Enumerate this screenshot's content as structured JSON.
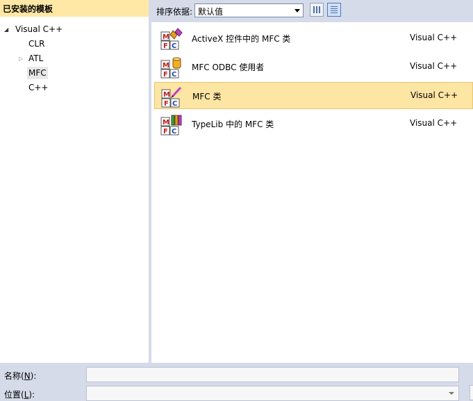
{
  "left_pane": {
    "header": "已安装的模板",
    "tree": [
      {
        "label": "Visual C++",
        "toggle": "◢"
      },
      {
        "label": "CLR"
      },
      {
        "label": "ATL",
        "toggle": "▷"
      },
      {
        "label": "MFC"
      },
      {
        "label": "C++"
      }
    ]
  },
  "toolbar": {
    "sort_label": "排序依据:",
    "sort_value": "默认值",
    "view_buttons": [
      "medium-icons",
      "small-icons"
    ]
  },
  "templates": [
    {
      "name": "ActiveX 控件中的 MFC 类",
      "language": "Visual C++",
      "icon": "mfc-activex-icon"
    },
    {
      "name": "MFC ODBC 使用者",
      "language": "Visual C++",
      "icon": "mfc-odbc-icon"
    },
    {
      "name": "MFC 类",
      "language": "Visual C++",
      "icon": "mfc-class-icon",
      "selected": true
    },
    {
      "name": "TypeLib 中的 MFC 类",
      "language": "Visual C++",
      "icon": "mfc-typelib-icon"
    }
  ],
  "fields": {
    "name": {
      "label": "名称(",
      "accel": "N",
      "suffix": "):",
      "value": ""
    },
    "location": {
      "label": "位置(",
      "accel": "L",
      "suffix": "):",
      "value": ""
    }
  },
  "colors": {
    "header_bg": "#ffe8a6",
    "selected_row": "#fde5a3",
    "chrome": "#d6dbe9"
  }
}
